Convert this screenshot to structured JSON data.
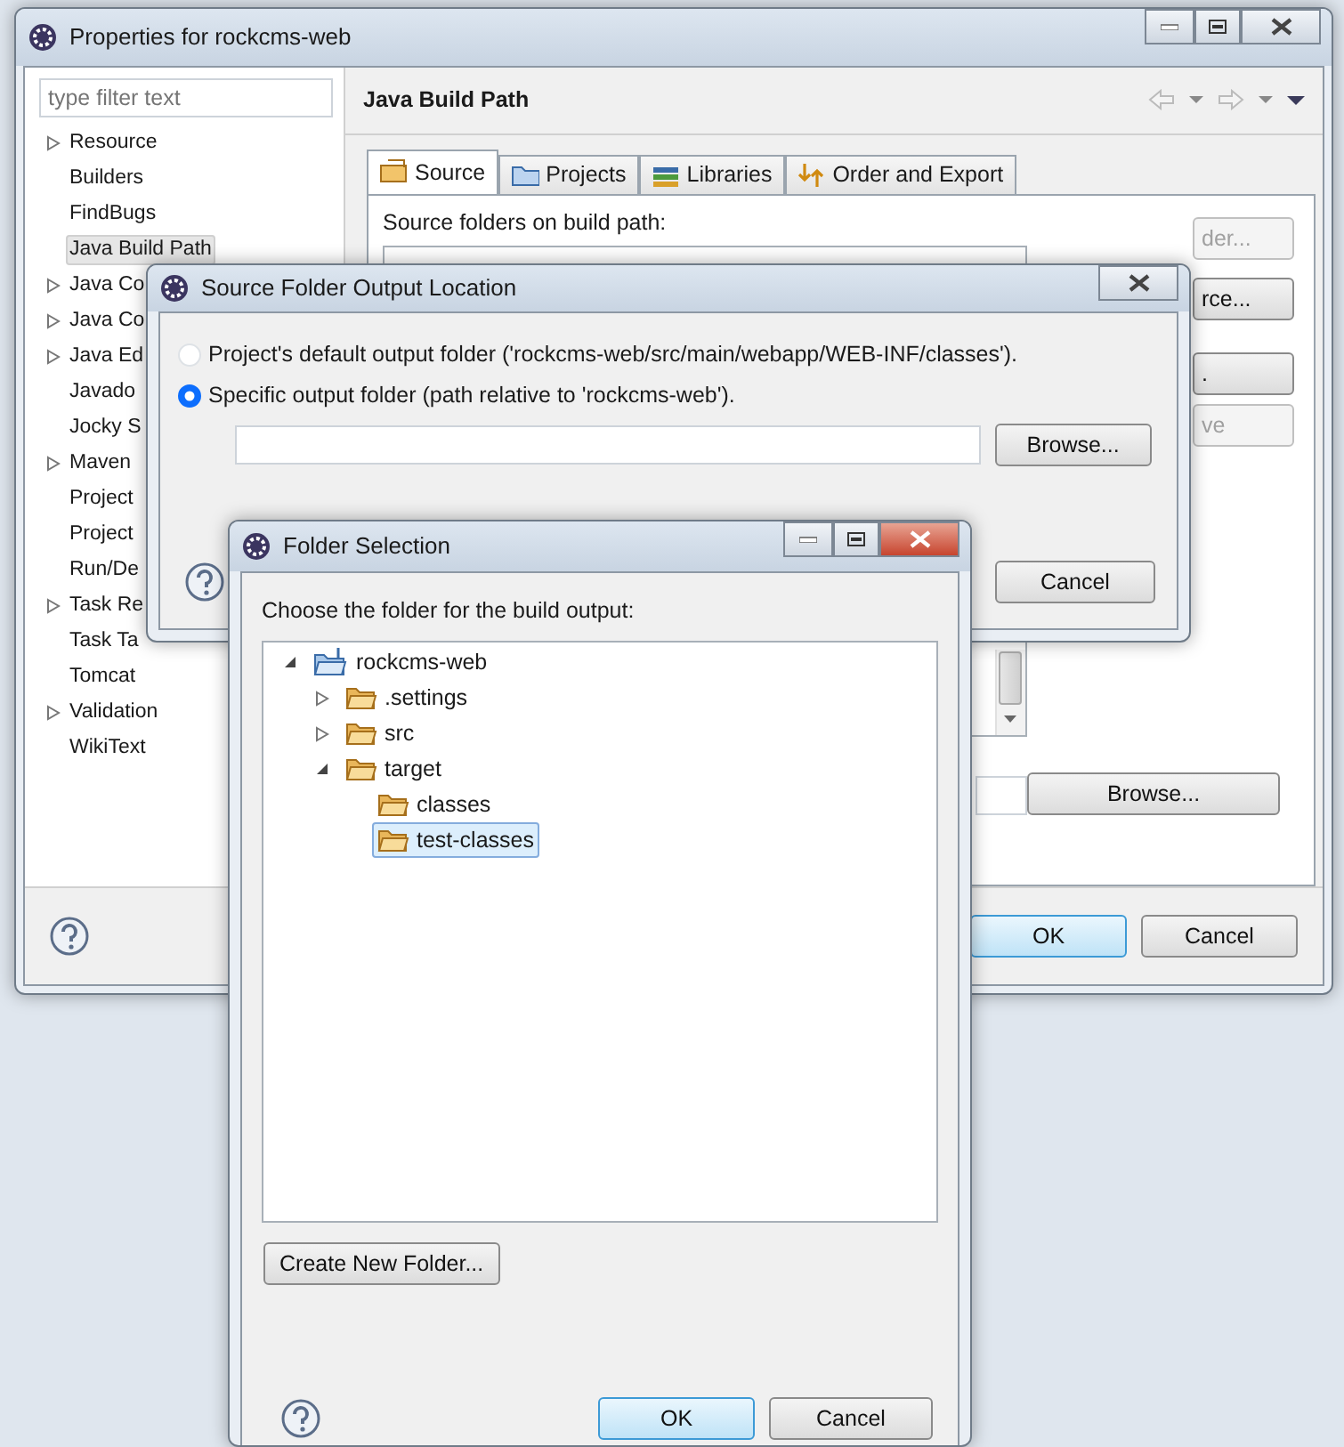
{
  "properties_window": {
    "title": "Properties for rockcms-web",
    "filter": {
      "placeholder": "type filter text"
    },
    "nav_items": [
      {
        "label": "Resource",
        "kind": "group",
        "selected": false
      },
      {
        "label": "Builders",
        "kind": "page",
        "selected": false
      },
      {
        "label": "FindBugs",
        "kind": "page",
        "selected": false
      },
      {
        "label": "Java Build Path",
        "kind": "page",
        "selected": true
      },
      {
        "label": "Java Co",
        "kind": "group",
        "selected": false
      },
      {
        "label": "Java Co",
        "kind": "group",
        "selected": false
      },
      {
        "label": "Java Ed",
        "kind": "group",
        "selected": false
      },
      {
        "label": "Javado",
        "kind": "page",
        "selected": false
      },
      {
        "label": "Jocky S",
        "kind": "page",
        "selected": false
      },
      {
        "label": "Maven",
        "kind": "group",
        "selected": false
      },
      {
        "label": "Project",
        "kind": "page",
        "selected": false
      },
      {
        "label": "Project",
        "kind": "page",
        "selected": false
      },
      {
        "label": "Run/De",
        "kind": "page",
        "selected": false
      },
      {
        "label": "Task Re",
        "kind": "group",
        "selected": false
      },
      {
        "label": "Task Ta",
        "kind": "page",
        "selected": false
      },
      {
        "label": "Tomcat",
        "kind": "page",
        "selected": false
      },
      {
        "label": "Validation",
        "kind": "group",
        "selected": false
      },
      {
        "label": "WikiText",
        "kind": "page",
        "selected": false
      }
    ],
    "page_title": "Java Build Path",
    "tabs": [
      {
        "label": "Source",
        "selected": true
      },
      {
        "label": "Projects",
        "selected": false
      },
      {
        "label": "Libraries",
        "selected": false
      },
      {
        "label": "Order and Export",
        "selected": false
      }
    ],
    "source_label": "Source folders on build path:",
    "side_buttons": [
      {
        "label": "der...",
        "disabled": true
      },
      {
        "label": "rce...",
        "disabled": false
      },
      {
        "label": ".",
        "disabled": false
      },
      {
        "label": "ve",
        "disabled": true
      }
    ],
    "browse_button": "Browse...",
    "ok_button": "OK",
    "cancel_button": "Cancel"
  },
  "output_location_dialog": {
    "title": "Source Folder Output Location",
    "options": [
      {
        "label": "Project's default output folder ('rockcms-web/src/main/webapp/WEB-INF/classes').",
        "selected": false
      },
      {
        "label": "Specific output folder (path relative to 'rockcms-web').",
        "selected": true
      }
    ],
    "browse_button": "Browse...",
    "cancel_button": "Cancel"
  },
  "folder_dialog": {
    "title": "Folder Selection",
    "prompt": "Choose the folder for the build output:",
    "tree": [
      {
        "label": "rockcms-web",
        "kind": "project",
        "expanded": true,
        "selected": false,
        "children": [
          {
            "label": ".settings",
            "kind": "folder",
            "expanded": false,
            "selected": false
          },
          {
            "label": "src",
            "kind": "folder",
            "expanded": false,
            "selected": false
          },
          {
            "label": "target",
            "kind": "folder",
            "expanded": true,
            "selected": false,
            "children": [
              {
                "label": "classes",
                "kind": "folder",
                "selected": false
              },
              {
                "label": "test-classes",
                "kind": "folder",
                "selected": true
              }
            ]
          }
        ]
      }
    ],
    "create_button": "Create New Folder...",
    "ok_button": "OK",
    "cancel_button": "Cancel"
  }
}
